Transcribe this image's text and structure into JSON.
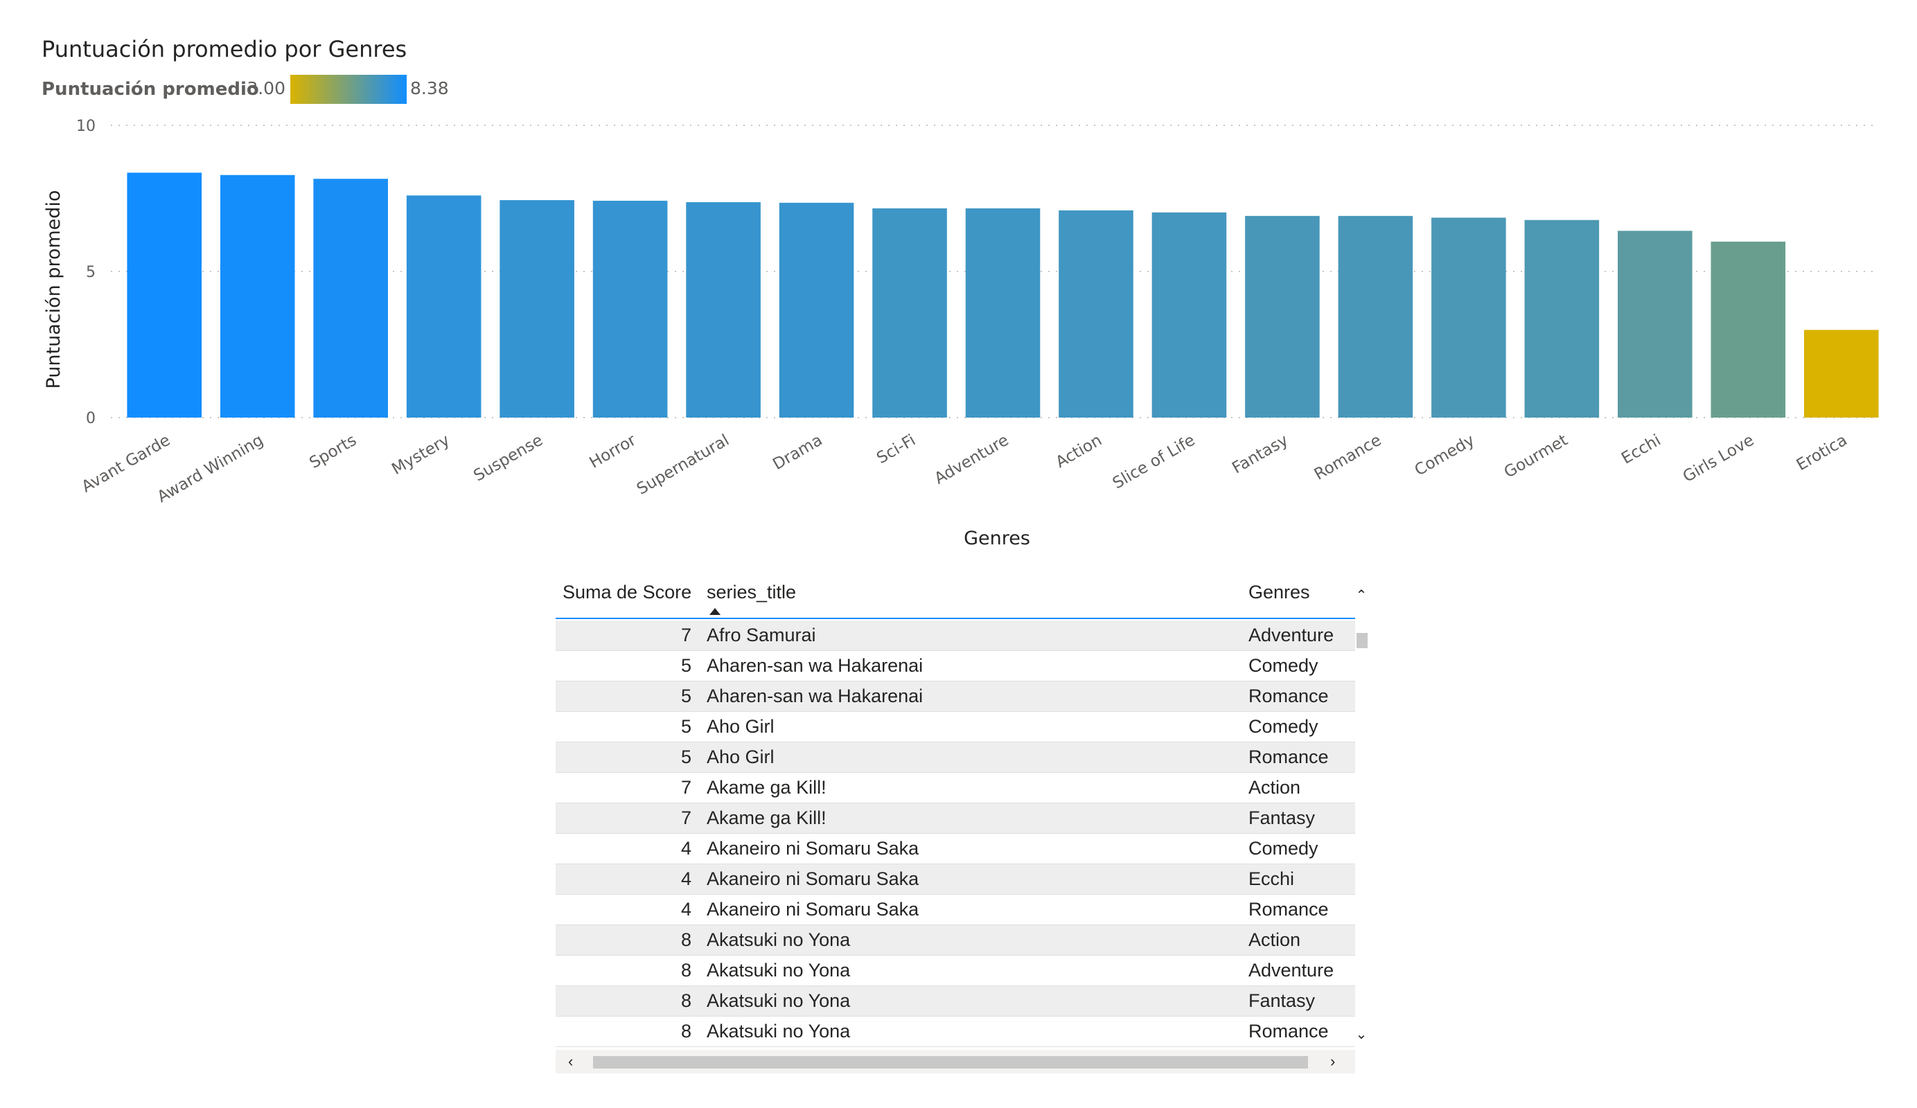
{
  "chart_data": {
    "type": "bar",
    "title": "Puntuación promedio por Genres",
    "legend": {
      "title": "Puntuación promedio",
      "min_label": "3.00",
      "max_label": "8.38",
      "min_color": "#d9b300",
      "max_color": "#118dff"
    },
    "xlabel": "Genres",
    "ylabel": "Puntuación promedio",
    "ylim": [
      0,
      10
    ],
    "yticks": [
      "0",
      "5",
      "10"
    ],
    "categories": [
      "Avant Garde",
      "Award Winning",
      "Sports",
      "Mystery",
      "Suspense",
      "Horror",
      "Supernatural",
      "Drama",
      "Sci-Fi",
      "Adventure",
      "Action",
      "Slice of Life",
      "Fantasy",
      "Romance",
      "Comedy",
      "Gourmet",
      "Ecchi",
      "Girls Love",
      "Erotica"
    ],
    "values": [
      8.38,
      8.3,
      8.17,
      7.6,
      7.44,
      7.42,
      7.37,
      7.35,
      7.16,
      7.16,
      7.09,
      7.02,
      6.9,
      6.9,
      6.84,
      6.76,
      6.39,
      6.02,
      3.0
    ],
    "grid": true,
    "legend_position": "top-left"
  },
  "table": {
    "columns": [
      "Suma de Score",
      "series_title",
      "Genres"
    ],
    "rows": [
      {
        "score": "7",
        "title": "Afro Samurai",
        "genre": "Adventure"
      },
      {
        "score": "5",
        "title": "Aharen-san wa Hakarenai",
        "genre": "Comedy"
      },
      {
        "score": "5",
        "title": "Aharen-san wa Hakarenai",
        "genre": "Romance"
      },
      {
        "score": "5",
        "title": "Aho Girl",
        "genre": "Comedy"
      },
      {
        "score": "5",
        "title": "Aho Girl",
        "genre": "Romance"
      },
      {
        "score": "7",
        "title": "Akame ga Kill!",
        "genre": "Action"
      },
      {
        "score": "7",
        "title": "Akame ga Kill!",
        "genre": "Fantasy"
      },
      {
        "score": "4",
        "title": "Akaneiro ni Somaru Saka",
        "genre": "Comedy"
      },
      {
        "score": "4",
        "title": "Akaneiro ni Somaru Saka",
        "genre": "Ecchi"
      },
      {
        "score": "4",
        "title": "Akaneiro ni Somaru Saka",
        "genre": "Romance"
      },
      {
        "score": "8",
        "title": "Akatsuki no Yona",
        "genre": "Action"
      },
      {
        "score": "8",
        "title": "Akatsuki no Yona",
        "genre": "Adventure"
      },
      {
        "score": "8",
        "title": "Akatsuki no Yona",
        "genre": "Fantasy"
      },
      {
        "score": "8",
        "title": "Akatsuki no Yona",
        "genre": "Romance"
      }
    ]
  },
  "icons": {
    "scroll_up": "chevron-up-icon",
    "scroll_down": "chevron-down-icon",
    "scroll_left": "chevron-left-icon",
    "scroll_right": "chevron-right-icon"
  }
}
